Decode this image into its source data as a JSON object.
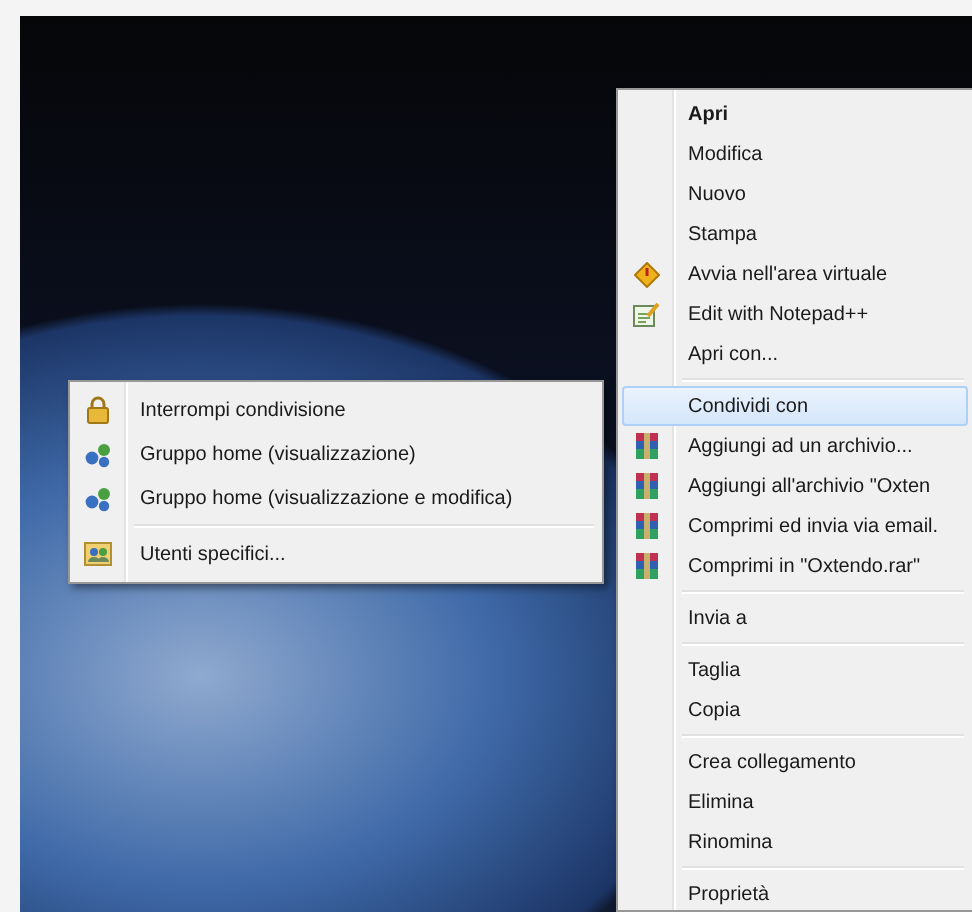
{
  "context_menu": {
    "groups": [
      [
        {
          "label": "Apri",
          "default": true,
          "kind": "plain",
          "selected": false
        },
        {
          "label": "Modifica",
          "default": false,
          "kind": "plain",
          "selected": false
        },
        {
          "label": "Nuovo",
          "default": false,
          "kind": "plain",
          "selected": false
        },
        {
          "label": "Stampa",
          "default": false,
          "kind": "plain",
          "selected": false
        },
        {
          "label": "Avvia nell'area virtuale",
          "default": false,
          "kind": "diamond",
          "selected": false
        },
        {
          "label": "Edit with Notepad++",
          "default": false,
          "kind": "notepad",
          "selected": false
        },
        {
          "label": "Apri con...",
          "default": false,
          "kind": "plain",
          "selected": false
        }
      ],
      [
        {
          "label": "Condividi con",
          "default": false,
          "kind": "plain",
          "selected": true
        },
        {
          "label": "Aggiungi ad un archivio...",
          "default": false,
          "kind": "archive",
          "selected": false
        },
        {
          "label": "Aggiungi all'archivio \"Oxten",
          "default": false,
          "kind": "archive",
          "selected": false
        },
        {
          "label": "Comprimi ed invia via email.",
          "default": false,
          "kind": "archive",
          "selected": false
        },
        {
          "label": "Comprimi in \"Oxtendo.rar\"",
          "default": false,
          "kind": "archive",
          "selected": false
        }
      ],
      [
        {
          "label": "Invia a",
          "default": false,
          "kind": "plain",
          "selected": false
        }
      ],
      [
        {
          "label": "Taglia",
          "default": false,
          "kind": "plain",
          "selected": false
        },
        {
          "label": "Copia",
          "default": false,
          "kind": "plain",
          "selected": false
        }
      ],
      [
        {
          "label": "Crea collegamento",
          "default": false,
          "kind": "plain",
          "selected": false
        },
        {
          "label": "Elimina",
          "default": false,
          "kind": "plain",
          "selected": false
        },
        {
          "label": "Rinomina",
          "default": false,
          "kind": "plain",
          "selected": false
        }
      ],
      [
        {
          "label": "Proprietà",
          "default": false,
          "kind": "plain",
          "selected": false
        }
      ]
    ]
  },
  "submenu": {
    "groups": [
      [
        {
          "label": "Interrompi condivisione",
          "kind": "lock"
        },
        {
          "label": "Gruppo home (visualizzazione)",
          "kind": "network"
        },
        {
          "label": "Gruppo home (visualizzazione e modifica)",
          "kind": "network"
        }
      ],
      [
        {
          "label": "Utenti specifici...",
          "kind": "users"
        }
      ]
    ]
  }
}
